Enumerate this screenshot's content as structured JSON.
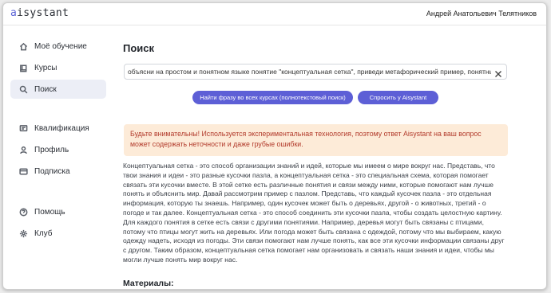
{
  "app": {
    "logo_accent": "a",
    "logo_rest": "isystant",
    "user_name": "Андрей Анатольевич Телятников"
  },
  "sidebar": {
    "items": [
      {
        "label": "Моё обучение",
        "icon": "home-icon"
      },
      {
        "label": "Курсы",
        "icon": "book-icon"
      },
      {
        "label": "Поиск",
        "icon": "search-icon",
        "active": true
      },
      {
        "label": "Квалификация",
        "icon": "diploma-icon"
      },
      {
        "label": "Профиль",
        "icon": "user-icon"
      },
      {
        "label": "Подписка",
        "icon": "card-icon"
      },
      {
        "label": "Помощь",
        "icon": "help-icon"
      },
      {
        "label": "Клуб",
        "icon": "club-icon"
      }
    ]
  },
  "main": {
    "title": "Поиск",
    "search": {
      "value": "объясни на простом и понятном языке понятие \"концептуальная сетка\", приведи метафорический пример, понятный ш"
    },
    "buttons": {
      "fulltext": "Найти фразу во всех курсах (полнотекстовый поиск)",
      "ask": "Спросить у Aisystant"
    },
    "warning": "Будьте внимательны! Используется экспериментальная технология, поэтому ответ Aisystant на ваш вопрос может содержать неточности и даже грубые ошибки.",
    "answer": "Концептуальная сетка - это способ организации знаний и идей, которые мы имеем о мире вокруг нас. Представь, что твои знания и идеи - это разные кусочки пазла, а концептуальная сетка - это специальная схема, которая помогает связать эти кусочки вместе. В этой сетке есть различные понятия и связи между ними, которые помогают нам лучше понять и объяснить мир. Давай рассмотрим пример с пазлом. Представь, что каждый кусочек пазла - это отдельная информация, которую ты знаешь. Например, один кусочек может быть о деревьях, другой - о животных, третий - о погоде и так далее. Концептуальная сетка - это способ соединить эти кусочки пазла, чтобы создать целостную картину. Для каждого понятия в сетке есть связи с другими понятиями. Например, деревья могут быть связаны с птицами, потому что птицы могут жить на деревьях. Или погода может быть связана с одеждой, потому что мы выбираем, какую одежду надеть, исходя из погоды. Эти связи помогают нам лучше понять, как все эти кусочки информации связаны друг с другом. Таким образом, концептуальная сетка помогает нам организовать и связать наши знания и идеи, чтобы мы могли лучше понять мир вокруг нас.",
    "materials_heading": "Материалы:"
  },
  "colors": {
    "accent": "#5d5fd6",
    "warning_bg": "#fdebd8",
    "warning_text": "#b23b2c",
    "active_nav_bg": "#eceef6"
  }
}
